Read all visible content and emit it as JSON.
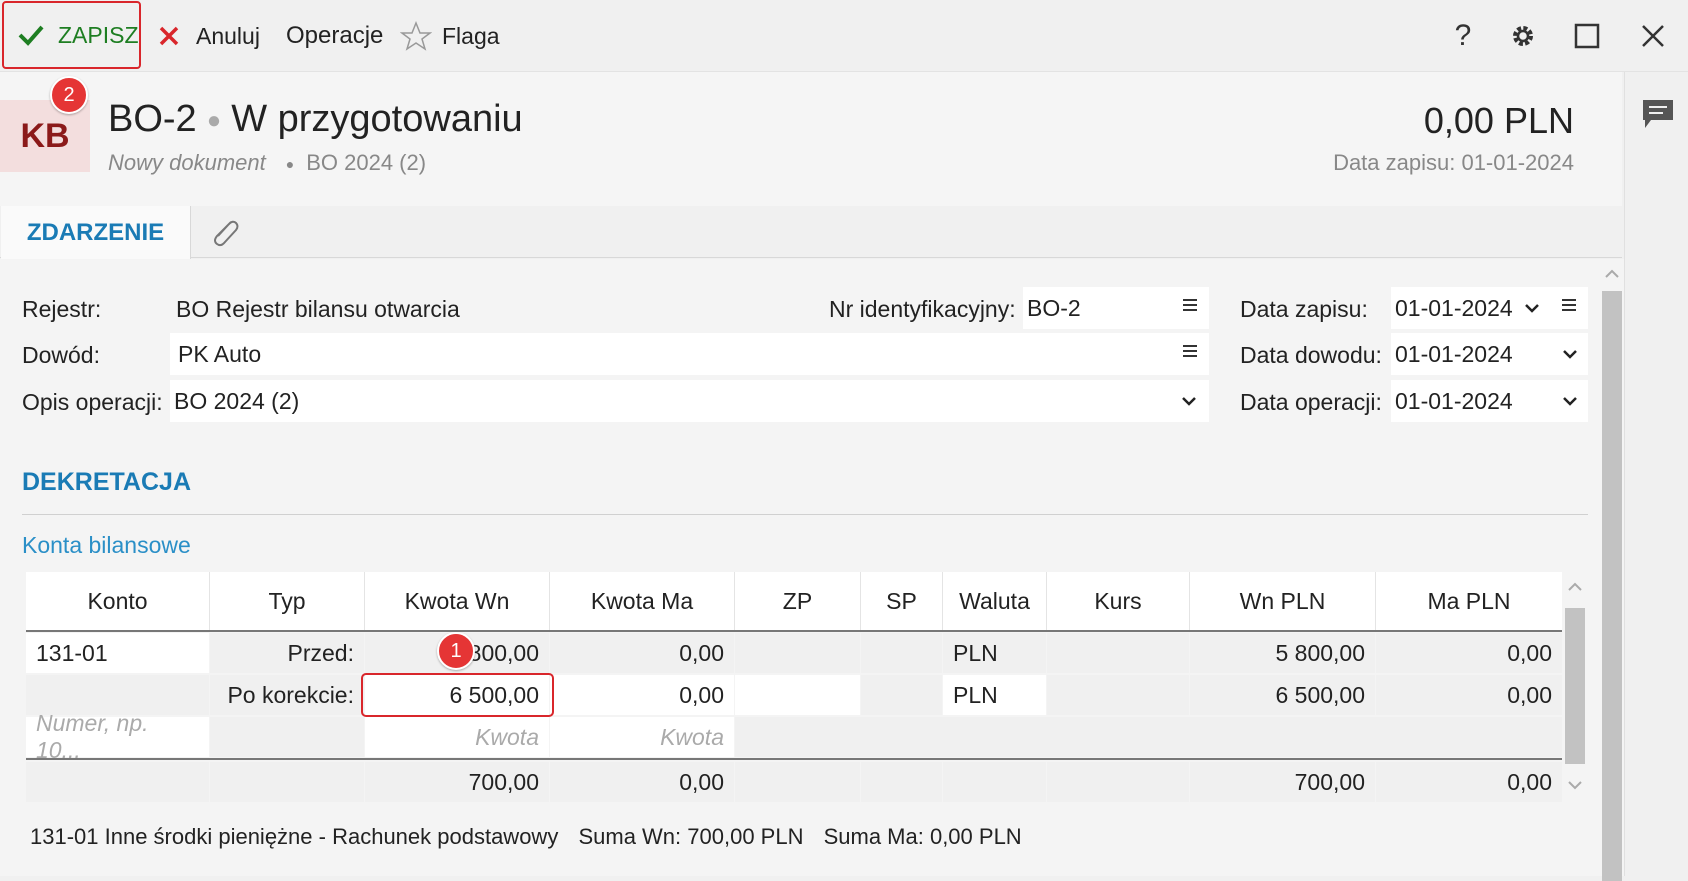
{
  "toolbar": {
    "save_label": "ZAPISZ",
    "cancel_label": "Anuluj",
    "operations_label": "Operacje",
    "flag_label": "Flaga"
  },
  "header": {
    "doc_type_abbr": "KB",
    "doc_number": "BO-2",
    "status": "W przygotowaniu",
    "subtitle_new": "Nowy dokument",
    "subtitle_ref": "BO 2024 (2)",
    "amount": "0,00 PLN",
    "date_entry_label": "Data zapisu: 01-01-2024"
  },
  "badges": {
    "save_step": "2",
    "amount_step": "1"
  },
  "tabs": {
    "event": "ZDARZENIE"
  },
  "form": {
    "register_label": "Rejestr:",
    "register_value": "BO Rejestr bilansu otwarcia",
    "id_label": "Nr identyfikacyjny:",
    "id_value": "BO-2",
    "proof_label": "Dowód:",
    "proof_value": "PK Auto",
    "desc_label": "Opis operacji:",
    "desc_value": "BO 2024 (2)",
    "date_entry_label": "Data zapisu:",
    "date_entry_value": "01-01-2024",
    "date_proof_label": "Data dowodu:",
    "date_proof_value": "01-01-2024",
    "date_op_label": "Data operacji:",
    "date_op_value": "01-01-2024"
  },
  "dekretacja": {
    "title": "DEKRETACJA",
    "subtitle": "Konta bilansowe",
    "columns": [
      "Konto",
      "Typ",
      "Kwota Wn",
      "Kwota Ma",
      "ZP",
      "SP",
      "Waluta",
      "Kurs",
      "Wn PLN",
      "Ma PLN"
    ],
    "row_before": {
      "konto": "131-01",
      "typ": "Przed:",
      "wn": "5 800,00",
      "ma": "0,00",
      "waluta": "PLN",
      "wn_pln": "5 800,00",
      "ma_pln": "0,00"
    },
    "row_after": {
      "typ": "Po korekcie:",
      "wn": "6 500,00",
      "ma": "0,00",
      "waluta": "PLN",
      "wn_pln": "6 500,00",
      "ma_pln": "0,00"
    },
    "new_row": {
      "konto_placeholder": "Numer, np. 10...",
      "wn_placeholder": "Kwota",
      "ma_placeholder": "Kwota"
    },
    "totals": {
      "wn": "700,00",
      "ma": "0,00",
      "wn_pln": "700,00",
      "ma_pln": "0,00"
    }
  },
  "summary": {
    "account": "131-01 Inne środki pieniężne - Rachunek podstawowy",
    "sum_wn": "Suma Wn: 700,00 PLN",
    "sum_ma": "Suma Ma: 0,00 PLN"
  },
  "colors": {
    "accent": "#1a7bb5",
    "save_green": "#1e7e22",
    "highlight_red": "#d9262b",
    "badge_red": "#e53535"
  }
}
